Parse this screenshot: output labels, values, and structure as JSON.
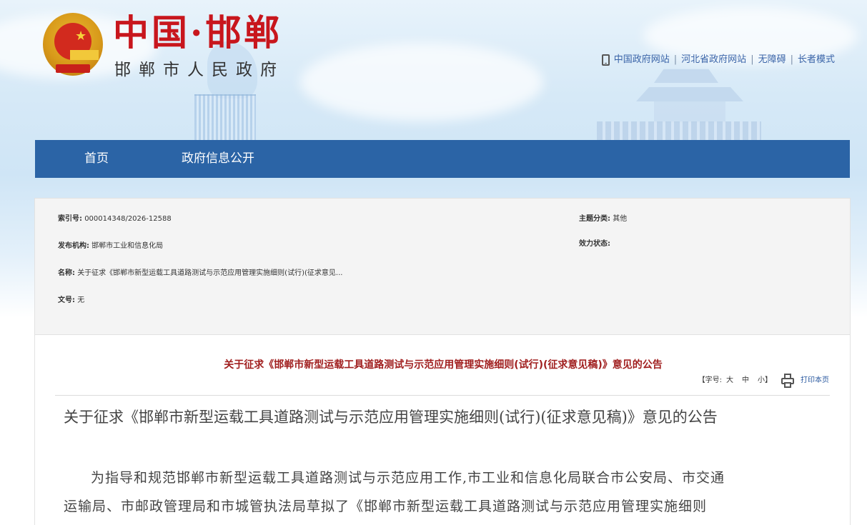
{
  "header": {
    "site_title": "中国·邯郸",
    "site_subtitle": "邯郸市人民政府",
    "top_links": [
      "中国政府网站",
      "河北省政府网站",
      "无障碍",
      "长者模式"
    ],
    "top_link_separator": "|"
  },
  "nav": {
    "items": [
      {
        "label": "首页"
      },
      {
        "label": "政府信息公开"
      }
    ]
  },
  "info": {
    "index_no_label": "索引号:",
    "index_no_value": "000014348/2026-12588",
    "topic_label": "主题分类:",
    "topic_value": "其他",
    "publisher_label": "发布机构:",
    "publisher_value": "邯郸市工业和信息化局",
    "status_label": "效力状态:",
    "status_value": "",
    "name_label": "名称:",
    "name_value": "关于征求《邯郸市新型运载工具道路测试与示范应用管理实施细则(试行)(征求意见...",
    "doc_no_label": "文号:",
    "doc_no_value": "无"
  },
  "article": {
    "heading": "关于征求《邯郸市新型运载工具道路测试与示范应用管理实施细则(试行)(征求意见稿)》意见的公告",
    "font_size_label": "【字号:",
    "font_large": "大",
    "font_medium": "中",
    "font_small": "小】",
    "print_label": "打印本页",
    "doc_title": "关于征求《邯郸市新型运载工具道路测试与示范应用管理实施细则(试行)(征求意见稿)》意见的公告",
    "body_lines": [
      "为指导和规范邯郸市新型运载工具道路测试与示范应用工作,市工业和信息化局联合市公安局、市交通",
      "运输局、市邮政管理局和市城管执法局草拟了《邯郸市新型运载工具道路测试与示范应用管理实施细则"
    ]
  },
  "colors": {
    "nav_bg": "#2b64a6",
    "title_red": "#c8161d",
    "heading_red": "#a01e1e",
    "link_blue": "#3a64a8"
  },
  "icons": [
    "national-emblem",
    "phone-icon",
    "print-icon"
  ]
}
